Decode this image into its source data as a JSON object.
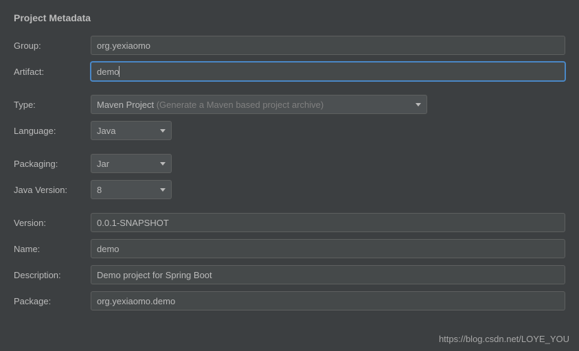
{
  "section_title": "Project Metadata",
  "labels": {
    "group": "Group:",
    "artifact": "Artifact:",
    "type": "Type:",
    "language": "Language:",
    "packaging": "Packaging:",
    "java_version": "Java Version:",
    "version": "Version:",
    "name": "Name:",
    "description": "Description:",
    "package": "Package:"
  },
  "values": {
    "group": "org.yexiaomo",
    "artifact": "demo",
    "version": "0.0.1-SNAPSHOT",
    "name": "demo",
    "description": "Demo project for Spring Boot",
    "package": "org.yexiaomo.demo"
  },
  "selects": {
    "type_main": "Maven Project",
    "type_hint": " (Generate a Maven based project archive)",
    "language": "Java",
    "packaging": "Jar",
    "java_version": "8"
  },
  "watermark": "https://blog.csdn.net/LOYE_YOU"
}
